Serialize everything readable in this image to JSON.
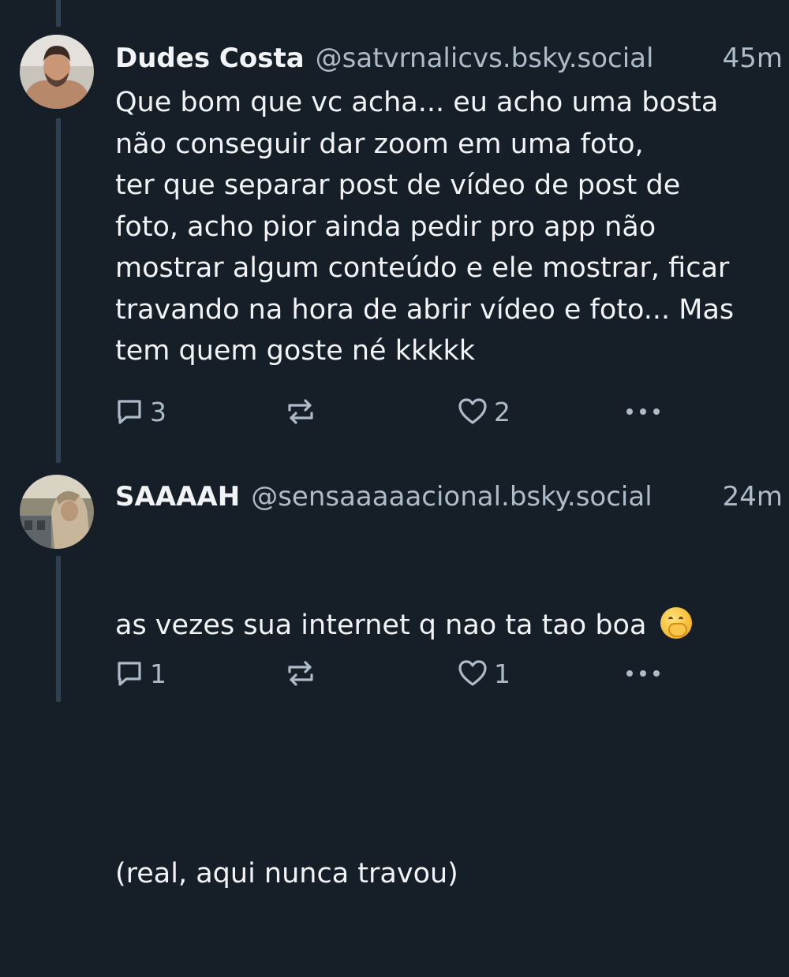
{
  "posts": [
    {
      "display_name": "Dudes Costa",
      "handle": "@satvrnalicvs.bsky.social",
      "time": "45m",
      "text": "Que bom que vc acha... eu acho uma bosta\nnão conseguir dar zoom em uma foto,\nter que separar post de vídeo de post de\nfoto, acho pior ainda pedir pro app não\nmostrar algum conteúdo e ele mostrar, ficar\ntravando na hora de abrir vídeo e foto... Mas\ntem quem goste né kkkkk",
      "reply_count": "3",
      "like_count": "2"
    },
    {
      "display_name": "SAAAAH",
      "handle": "@sensaaaaacional.bsky.social",
      "time": "24m",
      "text_line1": "as vezes sua internet q nao ta tao boa",
      "emoji_icon": "face-with-hand-over-mouth-emoji",
      "text_line2": "(real, aqui nunca travou)",
      "reply_count": "1",
      "like_count": "1"
    }
  ],
  "icons": {
    "reply": "speech-bubble-icon",
    "repost": "repost-arrows-icon",
    "like": "heart-icon",
    "more": "ellipsis-icon"
  },
  "colors": {
    "background": "#161e27",
    "text": "#f1f3f5",
    "muted": "#aebbc9",
    "thread_line": "#2e4052"
  }
}
